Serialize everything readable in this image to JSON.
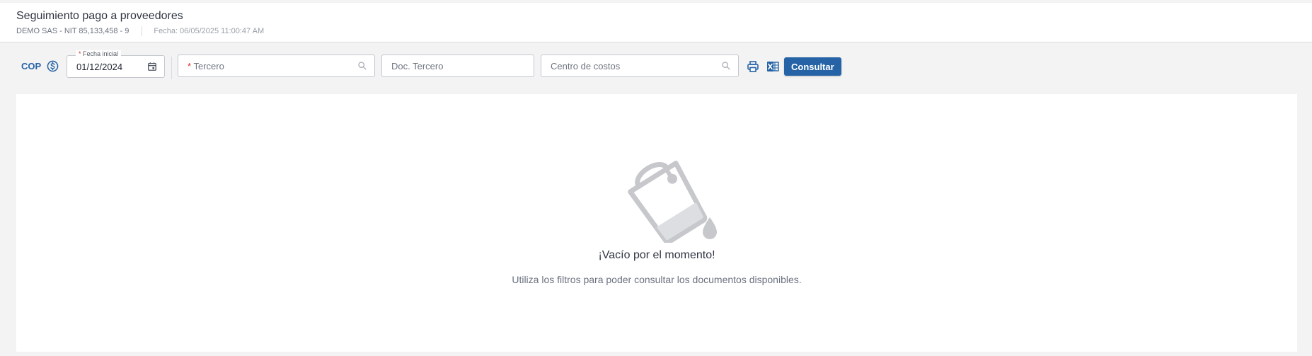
{
  "header": {
    "title": "Seguimiento pago a proveedores",
    "company": "DEMO SAS - NIT 85,133,458 - 9",
    "date": "Fecha: 06/05/2025 11:00:47 AM"
  },
  "toolbar": {
    "currency": "COP",
    "fecha_inicial": {
      "label": "Fecha inicial",
      "required_mark": "*",
      "value": "01/12/2024"
    },
    "tercero": {
      "required_mark": "*",
      "placeholder": "Tercero"
    },
    "doc_tercero": {
      "placeholder": "Doc. Tercero"
    },
    "centro_costos": {
      "placeholder": "Centro de costos"
    },
    "consultar_label": "Consultar"
  },
  "empty_state": {
    "title": "¡Vacío por el momento!",
    "message": "Utiliza los filtros para poder consultar los documentos disponibles."
  },
  "icons": {
    "currency": "dollar-circle-icon",
    "calendar": "calendar-icon",
    "search": "search-icon",
    "print": "printer-icon",
    "excel": "excel-icon",
    "empty": "empty-bucket-icon"
  },
  "colors": {
    "accent": "#2563a6",
    "required": "#d92b2b",
    "background": "#f3f3f4"
  }
}
